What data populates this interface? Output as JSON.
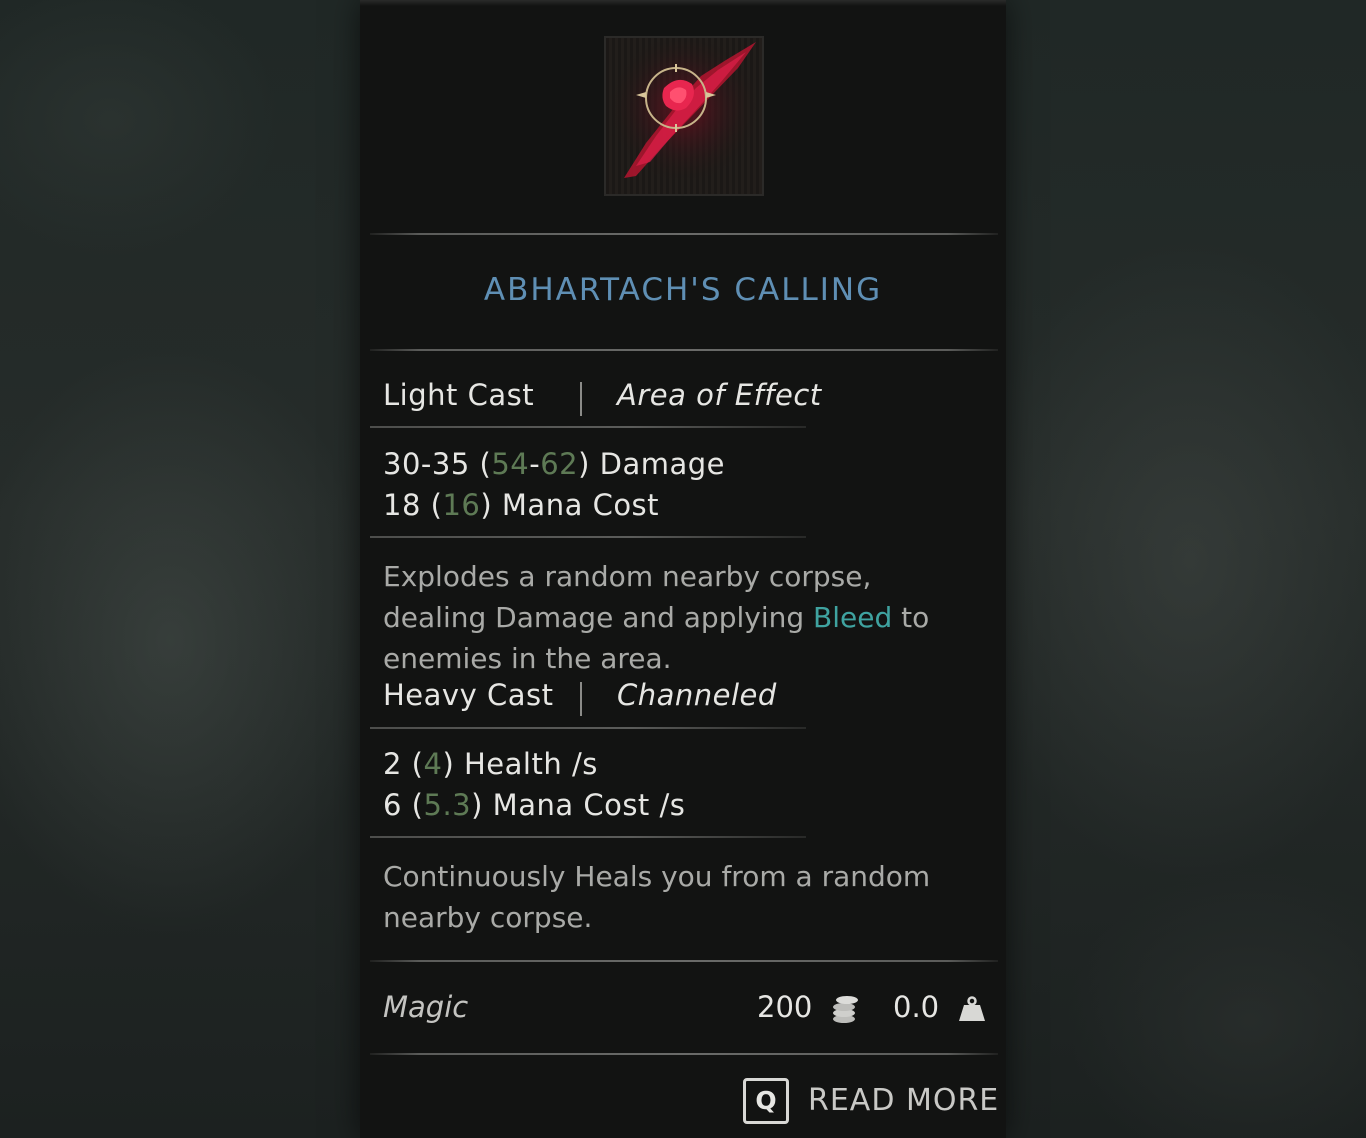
{
  "item": {
    "icon": "bleeding-claw-rune-icon",
    "title": "ABHARTACH'S CALLING",
    "light_cast": {
      "label": "Light Cast",
      "type": "Area of Effect",
      "damage": {
        "base": "30-35",
        "open": " (",
        "up_a": "54",
        "dash": "-",
        "up_b": "62",
        "close": ")",
        "suffix": " Damage"
      },
      "mana": {
        "base": "18",
        "open": " (",
        "up": "16",
        "close": ")",
        "suffix": " Mana Cost"
      },
      "desc_pre": "Explodes a random nearby corpse, dealing Damage and applying ",
      "desc_keyword": "Bleed",
      "desc_post": " to enemies in the area."
    },
    "heavy_cast": {
      "label": "Heavy Cast",
      "type": "Channeled",
      "health": {
        "base": "2",
        "open": " (",
        "up": "4",
        "close": ")",
        "suffix": " Health /s"
      },
      "mana": {
        "base": "6",
        "open": " (",
        "up": "5.3",
        "close": ")",
        "suffix": " Mana Cost /s"
      },
      "desc": "Continuously Heals you from a random nearby corpse."
    },
    "category": "Magic",
    "price": "200",
    "weight": "0.0",
    "read_more_key": "Q",
    "read_more_label": "READ MORE"
  },
  "colors": {
    "title": "#5f8fb4",
    "upgrade_value": "#5e7a55",
    "keyword": "#3fa3a0",
    "icon_accent": "#c4183c"
  }
}
